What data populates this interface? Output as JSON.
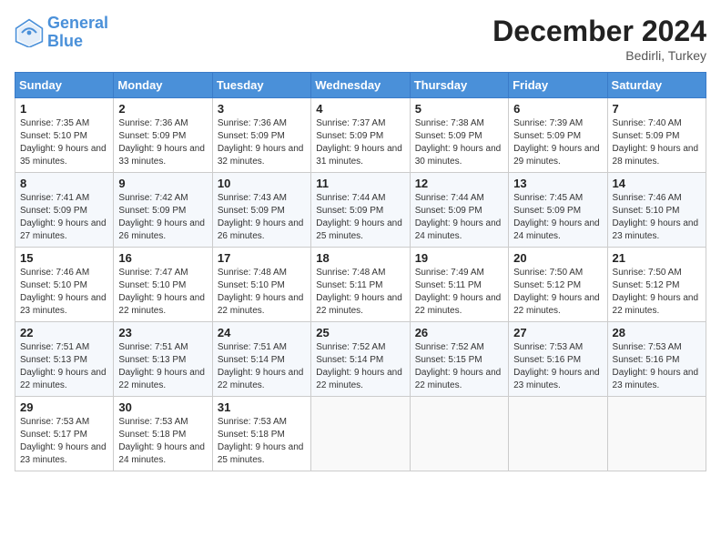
{
  "logo": {
    "line1": "General",
    "line2": "Blue"
  },
  "title": "December 2024",
  "subtitle": "Bedirli, Turkey",
  "weekdays": [
    "Sunday",
    "Monday",
    "Tuesday",
    "Wednesday",
    "Thursday",
    "Friday",
    "Saturday"
  ],
  "days": [
    {
      "day": "",
      "sunrise": "",
      "sunset": "",
      "daylight": ""
    },
    {
      "day": "",
      "sunrise": "",
      "sunset": "",
      "daylight": ""
    },
    {
      "day": "",
      "sunrise": "",
      "sunset": "",
      "daylight": ""
    },
    {
      "day": "",
      "sunrise": "",
      "sunset": "",
      "daylight": ""
    },
    {
      "day": "",
      "sunrise": "",
      "sunset": "",
      "daylight": ""
    },
    {
      "day": "",
      "sunrise": "",
      "sunset": "",
      "daylight": ""
    },
    {
      "day": "1",
      "sunrise": "Sunrise: 7:35 AM",
      "sunset": "Sunset: 5:10 PM",
      "daylight": "Daylight: 9 hours and 35 minutes."
    },
    {
      "day": "2",
      "sunrise": "Sunrise: 7:36 AM",
      "sunset": "Sunset: 5:09 PM",
      "daylight": "Daylight: 9 hours and 33 minutes."
    },
    {
      "day": "3",
      "sunrise": "Sunrise: 7:36 AM",
      "sunset": "Sunset: 5:09 PM",
      "daylight": "Daylight: 9 hours and 32 minutes."
    },
    {
      "day": "4",
      "sunrise": "Sunrise: 7:37 AM",
      "sunset": "Sunset: 5:09 PM",
      "daylight": "Daylight: 9 hours and 31 minutes."
    },
    {
      "day": "5",
      "sunrise": "Sunrise: 7:38 AM",
      "sunset": "Sunset: 5:09 PM",
      "daylight": "Daylight: 9 hours and 30 minutes."
    },
    {
      "day": "6",
      "sunrise": "Sunrise: 7:39 AM",
      "sunset": "Sunset: 5:09 PM",
      "daylight": "Daylight: 9 hours and 29 minutes."
    },
    {
      "day": "7",
      "sunrise": "Sunrise: 7:40 AM",
      "sunset": "Sunset: 5:09 PM",
      "daylight": "Daylight: 9 hours and 28 minutes."
    },
    {
      "day": "8",
      "sunrise": "Sunrise: 7:41 AM",
      "sunset": "Sunset: 5:09 PM",
      "daylight": "Daylight: 9 hours and 27 minutes."
    },
    {
      "day": "9",
      "sunrise": "Sunrise: 7:42 AM",
      "sunset": "Sunset: 5:09 PM",
      "daylight": "Daylight: 9 hours and 26 minutes."
    },
    {
      "day": "10",
      "sunrise": "Sunrise: 7:43 AM",
      "sunset": "Sunset: 5:09 PM",
      "daylight": "Daylight: 9 hours and 26 minutes."
    },
    {
      "day": "11",
      "sunrise": "Sunrise: 7:44 AM",
      "sunset": "Sunset: 5:09 PM",
      "daylight": "Daylight: 9 hours and 25 minutes."
    },
    {
      "day": "12",
      "sunrise": "Sunrise: 7:44 AM",
      "sunset": "Sunset: 5:09 PM",
      "daylight": "Daylight: 9 hours and 24 minutes."
    },
    {
      "day": "13",
      "sunrise": "Sunrise: 7:45 AM",
      "sunset": "Sunset: 5:09 PM",
      "daylight": "Daylight: 9 hours and 24 minutes."
    },
    {
      "day": "14",
      "sunrise": "Sunrise: 7:46 AM",
      "sunset": "Sunset: 5:10 PM",
      "daylight": "Daylight: 9 hours and 23 minutes."
    },
    {
      "day": "15",
      "sunrise": "Sunrise: 7:46 AM",
      "sunset": "Sunset: 5:10 PM",
      "daylight": "Daylight: 9 hours and 23 minutes."
    },
    {
      "day": "16",
      "sunrise": "Sunrise: 7:47 AM",
      "sunset": "Sunset: 5:10 PM",
      "daylight": "Daylight: 9 hours and 22 minutes."
    },
    {
      "day": "17",
      "sunrise": "Sunrise: 7:48 AM",
      "sunset": "Sunset: 5:10 PM",
      "daylight": "Daylight: 9 hours and 22 minutes."
    },
    {
      "day": "18",
      "sunrise": "Sunrise: 7:48 AM",
      "sunset": "Sunset: 5:11 PM",
      "daylight": "Daylight: 9 hours and 22 minutes."
    },
    {
      "day": "19",
      "sunrise": "Sunrise: 7:49 AM",
      "sunset": "Sunset: 5:11 PM",
      "daylight": "Daylight: 9 hours and 22 minutes."
    },
    {
      "day": "20",
      "sunrise": "Sunrise: 7:50 AM",
      "sunset": "Sunset: 5:12 PM",
      "daylight": "Daylight: 9 hours and 22 minutes."
    },
    {
      "day": "21",
      "sunrise": "Sunrise: 7:50 AM",
      "sunset": "Sunset: 5:12 PM",
      "daylight": "Daylight: 9 hours and 22 minutes."
    },
    {
      "day": "22",
      "sunrise": "Sunrise: 7:51 AM",
      "sunset": "Sunset: 5:13 PM",
      "daylight": "Daylight: 9 hours and 22 minutes."
    },
    {
      "day": "23",
      "sunrise": "Sunrise: 7:51 AM",
      "sunset": "Sunset: 5:13 PM",
      "daylight": "Daylight: 9 hours and 22 minutes."
    },
    {
      "day": "24",
      "sunrise": "Sunrise: 7:51 AM",
      "sunset": "Sunset: 5:14 PM",
      "daylight": "Daylight: 9 hours and 22 minutes."
    },
    {
      "day": "25",
      "sunrise": "Sunrise: 7:52 AM",
      "sunset": "Sunset: 5:14 PM",
      "daylight": "Daylight: 9 hours and 22 minutes."
    },
    {
      "day": "26",
      "sunrise": "Sunrise: 7:52 AM",
      "sunset": "Sunset: 5:15 PM",
      "daylight": "Daylight: 9 hours and 22 minutes."
    },
    {
      "day": "27",
      "sunrise": "Sunrise: 7:53 AM",
      "sunset": "Sunset: 5:16 PM",
      "daylight": "Daylight: 9 hours and 23 minutes."
    },
    {
      "day": "28",
      "sunrise": "Sunrise: 7:53 AM",
      "sunset": "Sunset: 5:16 PM",
      "daylight": "Daylight: 9 hours and 23 minutes."
    },
    {
      "day": "29",
      "sunrise": "Sunrise: 7:53 AM",
      "sunset": "Sunset: 5:17 PM",
      "daylight": "Daylight: 9 hours and 23 minutes."
    },
    {
      "day": "30",
      "sunrise": "Sunrise: 7:53 AM",
      "sunset": "Sunset: 5:18 PM",
      "daylight": "Daylight: 9 hours and 24 minutes."
    },
    {
      "day": "31",
      "sunrise": "Sunrise: 7:53 AM",
      "sunset": "Sunset: 5:18 PM",
      "daylight": "Daylight: 9 hours and 25 minutes."
    }
  ]
}
